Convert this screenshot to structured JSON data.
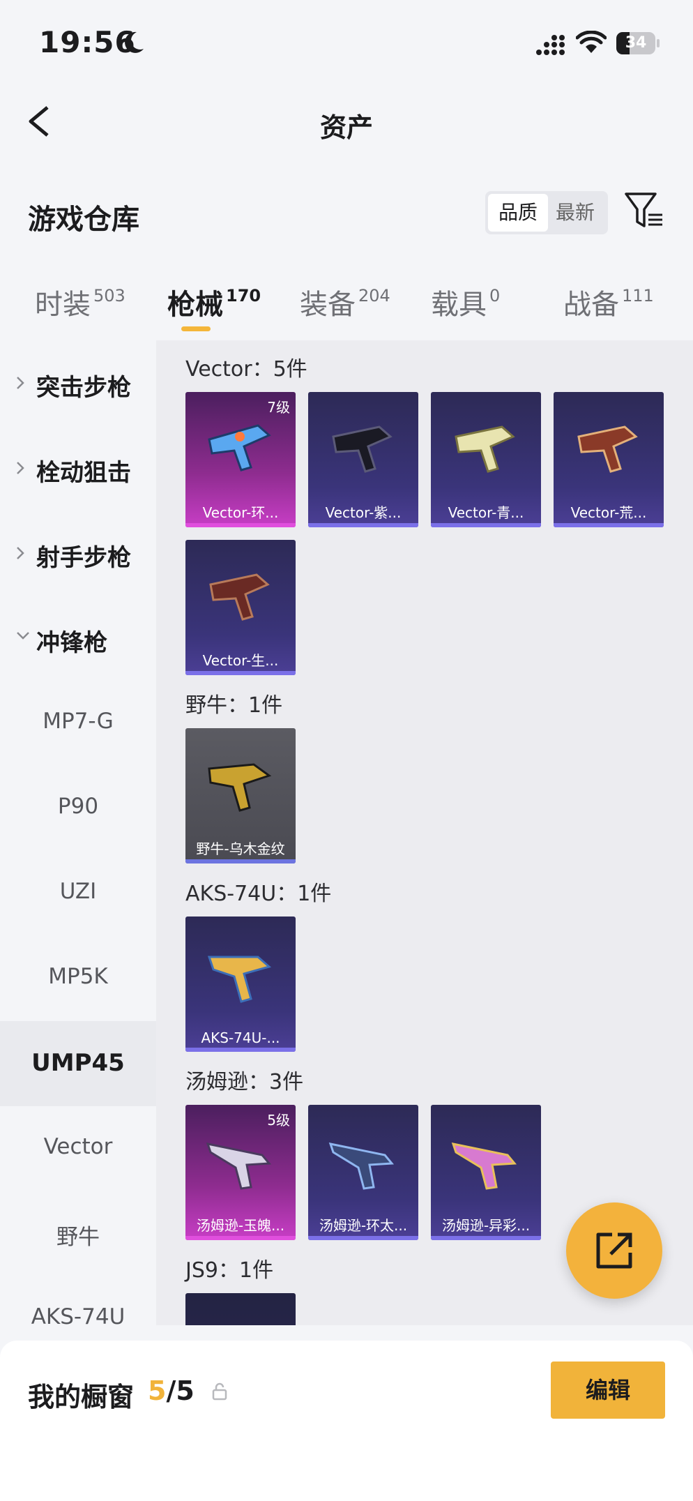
{
  "status_bar": {
    "time": "19:56",
    "battery": "34",
    "battery_level": 0.34
  },
  "header": {
    "title": "资产",
    "back_icon": "back-arrow-icon"
  },
  "warehouse": {
    "title": "游戏仓库",
    "sort_options": [
      "品质",
      "最新"
    ],
    "selected_sort": "品质",
    "filter_icon": "filter-icon"
  },
  "tabs": [
    {
      "label": "时装",
      "count": "503"
    },
    {
      "label": "枪械",
      "count": "170"
    },
    {
      "label": "装备",
      "count": "204"
    },
    {
      "label": "载具",
      "count": "0"
    },
    {
      "label": "战备",
      "count": "111"
    }
  ],
  "active_tab": "枪械",
  "sidebar": {
    "categories": [
      "突击步枪",
      "栓动狙击",
      "射手步枪",
      "冲锋枪"
    ],
    "subitems": [
      "MP7-G",
      "P90",
      "UZI",
      "MP5K",
      "UMP45",
      "Vector",
      "野牛",
      "AKS-74U"
    ],
    "active_subitem": "UMP45"
  },
  "groups": [
    {
      "title": "Vector：5件",
      "items": [
        {
          "name": "Vector-环...",
          "level": "7级",
          "rarity": "magenta"
        },
        {
          "name": "Vector-紫...",
          "rarity": "purple"
        },
        {
          "name": "Vector-青...",
          "rarity": "purple"
        },
        {
          "name": "Vector-荒...",
          "rarity": "purple"
        },
        {
          "name": "Vector-生...",
          "rarity": "purple"
        }
      ]
    },
    {
      "title": "野牛：1件",
      "items": [
        {
          "name": "野牛-乌木金纹",
          "rarity": "gray"
        }
      ]
    },
    {
      "title": "AKS-74U：1件",
      "items": [
        {
          "name": "AKS-74U-...",
          "rarity": "purple"
        }
      ]
    },
    {
      "title": "汤姆逊：3件",
      "items": [
        {
          "name": "汤姆逊-玉魄...",
          "level": "5级",
          "rarity": "magenta"
        },
        {
          "name": "汤姆逊-环太...",
          "rarity": "purple"
        },
        {
          "name": "汤姆逊-异彩...",
          "rarity": "purple"
        }
      ]
    },
    {
      "title": "JS9：1件",
      "items": [
        {
          "name": "",
          "rarity": "dark"
        }
      ]
    }
  ],
  "showcase": {
    "label": "我的橱窗",
    "current": "5",
    "total": "/5",
    "edit_label": "编辑"
  },
  "colors": {
    "accent": "#f1b33a",
    "purple_card": "#3a347a",
    "magenta_card": "#8e2c8f"
  }
}
